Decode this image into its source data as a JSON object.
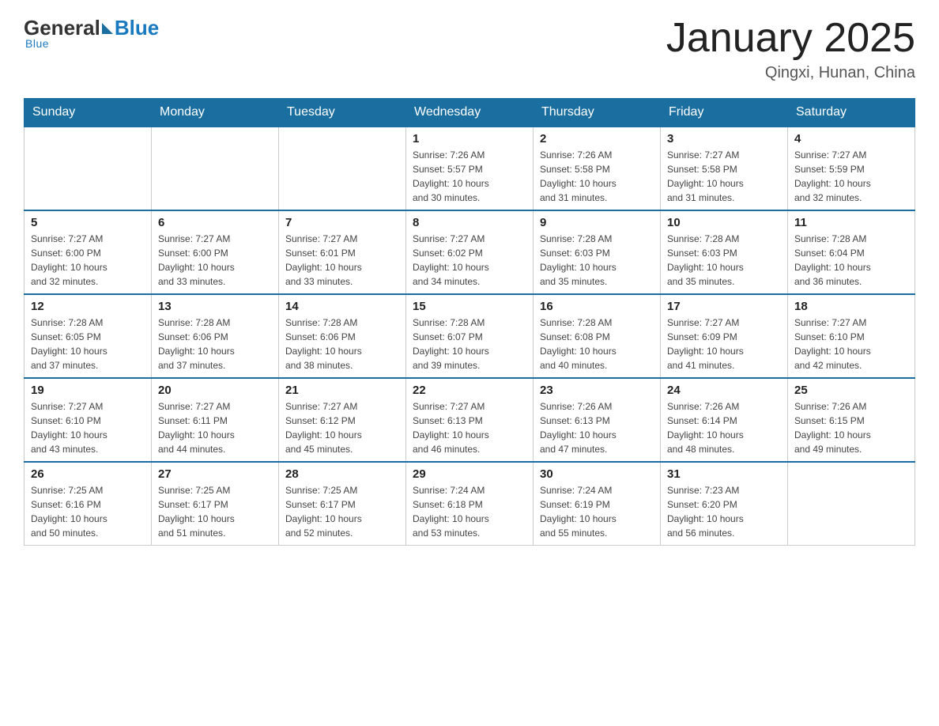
{
  "header": {
    "logo_general": "General",
    "logo_blue": "Blue",
    "month_title": "January 2025",
    "location": "Qingxi, Hunan, China"
  },
  "days_of_week": [
    "Sunday",
    "Monday",
    "Tuesday",
    "Wednesday",
    "Thursday",
    "Friday",
    "Saturday"
  ],
  "weeks": [
    [
      {
        "day": "",
        "info": ""
      },
      {
        "day": "",
        "info": ""
      },
      {
        "day": "",
        "info": ""
      },
      {
        "day": "1",
        "info": "Sunrise: 7:26 AM\nSunset: 5:57 PM\nDaylight: 10 hours\nand 30 minutes."
      },
      {
        "day": "2",
        "info": "Sunrise: 7:26 AM\nSunset: 5:58 PM\nDaylight: 10 hours\nand 31 minutes."
      },
      {
        "day": "3",
        "info": "Sunrise: 7:27 AM\nSunset: 5:58 PM\nDaylight: 10 hours\nand 31 minutes."
      },
      {
        "day": "4",
        "info": "Sunrise: 7:27 AM\nSunset: 5:59 PM\nDaylight: 10 hours\nand 32 minutes."
      }
    ],
    [
      {
        "day": "5",
        "info": "Sunrise: 7:27 AM\nSunset: 6:00 PM\nDaylight: 10 hours\nand 32 minutes."
      },
      {
        "day": "6",
        "info": "Sunrise: 7:27 AM\nSunset: 6:00 PM\nDaylight: 10 hours\nand 33 minutes."
      },
      {
        "day": "7",
        "info": "Sunrise: 7:27 AM\nSunset: 6:01 PM\nDaylight: 10 hours\nand 33 minutes."
      },
      {
        "day": "8",
        "info": "Sunrise: 7:27 AM\nSunset: 6:02 PM\nDaylight: 10 hours\nand 34 minutes."
      },
      {
        "day": "9",
        "info": "Sunrise: 7:28 AM\nSunset: 6:03 PM\nDaylight: 10 hours\nand 35 minutes."
      },
      {
        "day": "10",
        "info": "Sunrise: 7:28 AM\nSunset: 6:03 PM\nDaylight: 10 hours\nand 35 minutes."
      },
      {
        "day": "11",
        "info": "Sunrise: 7:28 AM\nSunset: 6:04 PM\nDaylight: 10 hours\nand 36 minutes."
      }
    ],
    [
      {
        "day": "12",
        "info": "Sunrise: 7:28 AM\nSunset: 6:05 PM\nDaylight: 10 hours\nand 37 minutes."
      },
      {
        "day": "13",
        "info": "Sunrise: 7:28 AM\nSunset: 6:06 PM\nDaylight: 10 hours\nand 37 minutes."
      },
      {
        "day": "14",
        "info": "Sunrise: 7:28 AM\nSunset: 6:06 PM\nDaylight: 10 hours\nand 38 minutes."
      },
      {
        "day": "15",
        "info": "Sunrise: 7:28 AM\nSunset: 6:07 PM\nDaylight: 10 hours\nand 39 minutes."
      },
      {
        "day": "16",
        "info": "Sunrise: 7:28 AM\nSunset: 6:08 PM\nDaylight: 10 hours\nand 40 minutes."
      },
      {
        "day": "17",
        "info": "Sunrise: 7:27 AM\nSunset: 6:09 PM\nDaylight: 10 hours\nand 41 minutes."
      },
      {
        "day": "18",
        "info": "Sunrise: 7:27 AM\nSunset: 6:10 PM\nDaylight: 10 hours\nand 42 minutes."
      }
    ],
    [
      {
        "day": "19",
        "info": "Sunrise: 7:27 AM\nSunset: 6:10 PM\nDaylight: 10 hours\nand 43 minutes."
      },
      {
        "day": "20",
        "info": "Sunrise: 7:27 AM\nSunset: 6:11 PM\nDaylight: 10 hours\nand 44 minutes."
      },
      {
        "day": "21",
        "info": "Sunrise: 7:27 AM\nSunset: 6:12 PM\nDaylight: 10 hours\nand 45 minutes."
      },
      {
        "day": "22",
        "info": "Sunrise: 7:27 AM\nSunset: 6:13 PM\nDaylight: 10 hours\nand 46 minutes."
      },
      {
        "day": "23",
        "info": "Sunrise: 7:26 AM\nSunset: 6:13 PM\nDaylight: 10 hours\nand 47 minutes."
      },
      {
        "day": "24",
        "info": "Sunrise: 7:26 AM\nSunset: 6:14 PM\nDaylight: 10 hours\nand 48 minutes."
      },
      {
        "day": "25",
        "info": "Sunrise: 7:26 AM\nSunset: 6:15 PM\nDaylight: 10 hours\nand 49 minutes."
      }
    ],
    [
      {
        "day": "26",
        "info": "Sunrise: 7:25 AM\nSunset: 6:16 PM\nDaylight: 10 hours\nand 50 minutes."
      },
      {
        "day": "27",
        "info": "Sunrise: 7:25 AM\nSunset: 6:17 PM\nDaylight: 10 hours\nand 51 minutes."
      },
      {
        "day": "28",
        "info": "Sunrise: 7:25 AM\nSunset: 6:17 PM\nDaylight: 10 hours\nand 52 minutes."
      },
      {
        "day": "29",
        "info": "Sunrise: 7:24 AM\nSunset: 6:18 PM\nDaylight: 10 hours\nand 53 minutes."
      },
      {
        "day": "30",
        "info": "Sunrise: 7:24 AM\nSunset: 6:19 PM\nDaylight: 10 hours\nand 55 minutes."
      },
      {
        "day": "31",
        "info": "Sunrise: 7:23 AM\nSunset: 6:20 PM\nDaylight: 10 hours\nand 56 minutes."
      },
      {
        "day": "",
        "info": ""
      }
    ]
  ]
}
